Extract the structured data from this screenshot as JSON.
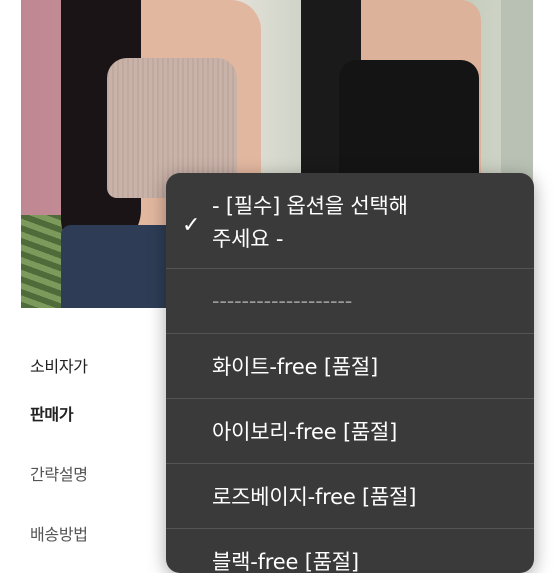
{
  "labels": {
    "retail_price": "소비자가",
    "sale_price": "판매가",
    "summary": "간략설명",
    "shipping_method": "배송방법"
  },
  "dropdown": {
    "selected_option": "- [필수] 옵션을 선택해 주세요 -",
    "selected_line1": "- [필수] 옵션을 선택해",
    "selected_line2": "주세요 -",
    "divider": "-------------------",
    "options": [
      "화이트-free [품절]",
      "아이보리-free [품절]",
      "로즈베이지-free [품절]",
      "블랙-free [품절]"
    ]
  },
  "colors": {
    "dropdown_bg": "#3b3a3a",
    "separator": "#555454",
    "text": "#ffffff"
  }
}
